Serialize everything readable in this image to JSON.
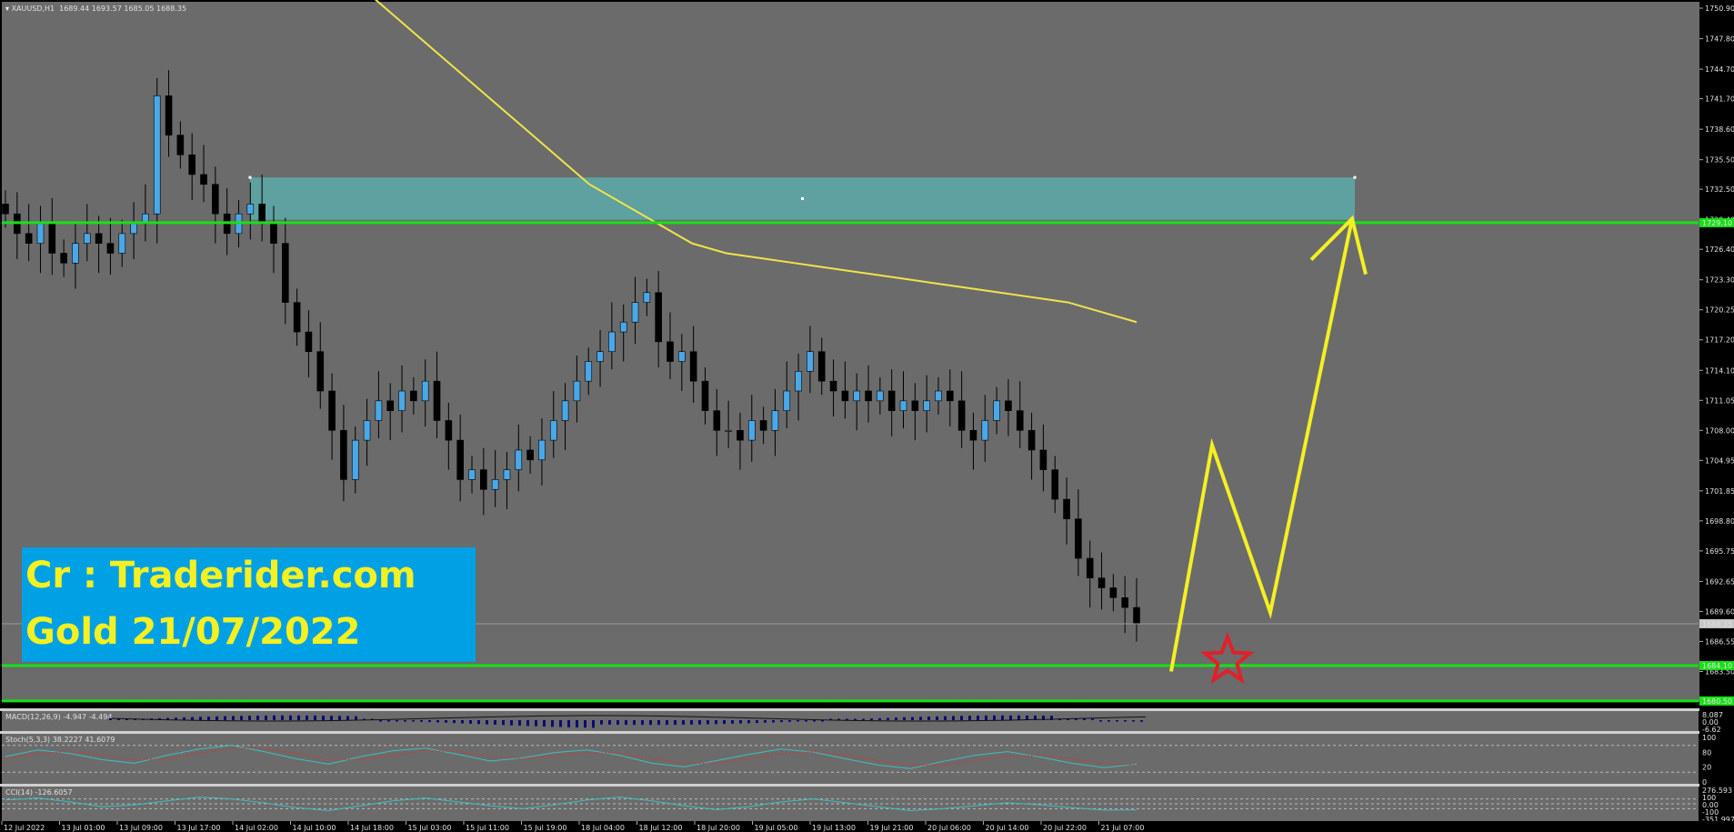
{
  "symbol_header": {
    "symbol": "XAUUSD,H1",
    "ohlc": "1689.44 1693.57 1685.05 1688.35"
  },
  "watermark": {
    "line1": "Cr : Traderider.com",
    "line2": "Gold 21/07/2022"
  },
  "colors": {
    "background": "#6b6b6b",
    "bull": "#4aa8e8",
    "bear": "#000000",
    "ma": "#f0e44a",
    "level": "#18e018",
    "zone": "#5fa0a0",
    "arrow": "#f4f022",
    "star": "#e0202a"
  },
  "indicators": {
    "macd": {
      "label": "MACD(12,26,9) -4.947 -4.494",
      "scale": [
        "8.087",
        "0.00",
        "-6.62"
      ]
    },
    "stoch": {
      "label": "Stoch(5,3,3) 38.2227 41.6079",
      "scale": [
        "100",
        "80",
        "20",
        "0"
      ]
    },
    "cci": {
      "label": "CCI(14) -126.6057",
      "scale": [
        "276.593",
        "100",
        "0.00",
        "-100",
        "-351.997"
      ]
    }
  },
  "chart_data": {
    "type": "candlestick",
    "price_axis_ticks": [
      "1750.90",
      "1747.80",
      "1744.70",
      "1741.70",
      "1738.60",
      "1735.50",
      "1732.50",
      "1729.40",
      "1726.40",
      "1723.30",
      "1720.25",
      "1717.20",
      "1714.10",
      "1711.05",
      "1708.00",
      "1704.95",
      "1701.85",
      "1698.80",
      "1695.75",
      "1692.65",
      "1689.60",
      "1686.55",
      "1683.50",
      "1680.40"
    ],
    "time_axis_ticks": [
      "12 Jul 2022",
      "13 Jul 01:00",
      "13 Jul 09:00",
      "13 Jul 17:00",
      "14 Jul 02:00",
      "14 Jul 10:00",
      "14 Jul 18:00",
      "15 Jul 03:00",
      "15 Jul 11:00",
      "15 Jul 19:00",
      "18 Jul 04:00",
      "18 Jul 12:00",
      "18 Jul 20:00",
      "19 Jul 05:00",
      "19 Jul 13:00",
      "19 Jul 21:00",
      "20 Jul 06:00",
      "20 Jul 14:00",
      "20 Jul 22:00",
      "21 Jul 07:00"
    ],
    "current_price": 1688.35,
    "levels": [
      1729.1,
      1684.1,
      1680.5
    ],
    "resistance_zone": [
      1729.4,
      1733.7
    ],
    "close_path": [
      1730,
      1728,
      1727,
      1729,
      1726,
      1725,
      1727,
      1728,
      1727,
      1726,
      1728,
      1729,
      1730,
      1742,
      1738,
      1736,
      1734,
      1733,
      1730,
      1728,
      1730,
      1731,
      1729,
      1727,
      1721,
      1718,
      1716,
      1712,
      1708,
      1703,
      1707,
      1709,
      1711,
      1710,
      1712,
      1711,
      1713,
      1709,
      1707,
      1703,
      1704,
      1702,
      1703,
      1704,
      1706,
      1705,
      1707,
      1709,
      1711,
      1713,
      1715,
      1716,
      1718,
      1719,
      1721,
      1722,
      1717,
      1715,
      1716,
      1713,
      1710,
      1708,
      1708,
      1707,
      1709,
      1708,
      1710,
      1712,
      1714,
      1716,
      1713,
      1712,
      1711,
      1712,
      1711,
      1712,
      1710,
      1711,
      1710,
      1711,
      1712,
      1711,
      1708,
      1707,
      1709,
      1711,
      1710,
      1708,
      1706,
      1704,
      1701,
      1699,
      1695,
      1693,
      1692,
      1691,
      1690,
      1688.35
    ],
    "ma_path": [
      1754,
      1751,
      1748,
      1745,
      1742,
      1739,
      1736,
      1733,
      1731,
      1729,
      1727,
      1726,
      1725.5,
      1725,
      1724.5,
      1724,
      1723.5,
      1723,
      1722.5,
      1722,
      1721.5,
      1721,
      1720,
      1719
    ],
    "projection": [
      1683.5,
      1706.5,
      1689.5,
      1729.5
    ],
    "stoch_k": [
      55,
      70,
      62,
      48,
      40,
      58,
      72,
      80,
      66,
      50,
      38,
      55,
      68,
      74,
      60,
      45,
      52,
      64,
      70,
      58,
      40,
      32,
      46,
      60,
      72,
      65,
      50,
      36,
      28,
      44,
      58,
      66,
      54,
      40,
      30,
      38
    ],
    "stoch_d": [
      50,
      62,
      66,
      58,
      48,
      50,
      62,
      74,
      74,
      62,
      48,
      48,
      58,
      68,
      66,
      56,
      50,
      56,
      64,
      62,
      52,
      40,
      40,
      50,
      62,
      66,
      58,
      46,
      36,
      36,
      46,
      56,
      58,
      50,
      40,
      36
    ],
    "cci": [
      80,
      120,
      40,
      -60,
      -20,
      60,
      140,
      100,
      20,
      -80,
      -140,
      -40,
      60,
      120,
      40,
      -40,
      -100,
      -20,
      80,
      140,
      60,
      -40,
      -120,
      -60,
      40,
      100,
      20,
      -60,
      -140,
      -100,
      -40,
      20,
      -20,
      -80,
      -130,
      -126
    ]
  }
}
